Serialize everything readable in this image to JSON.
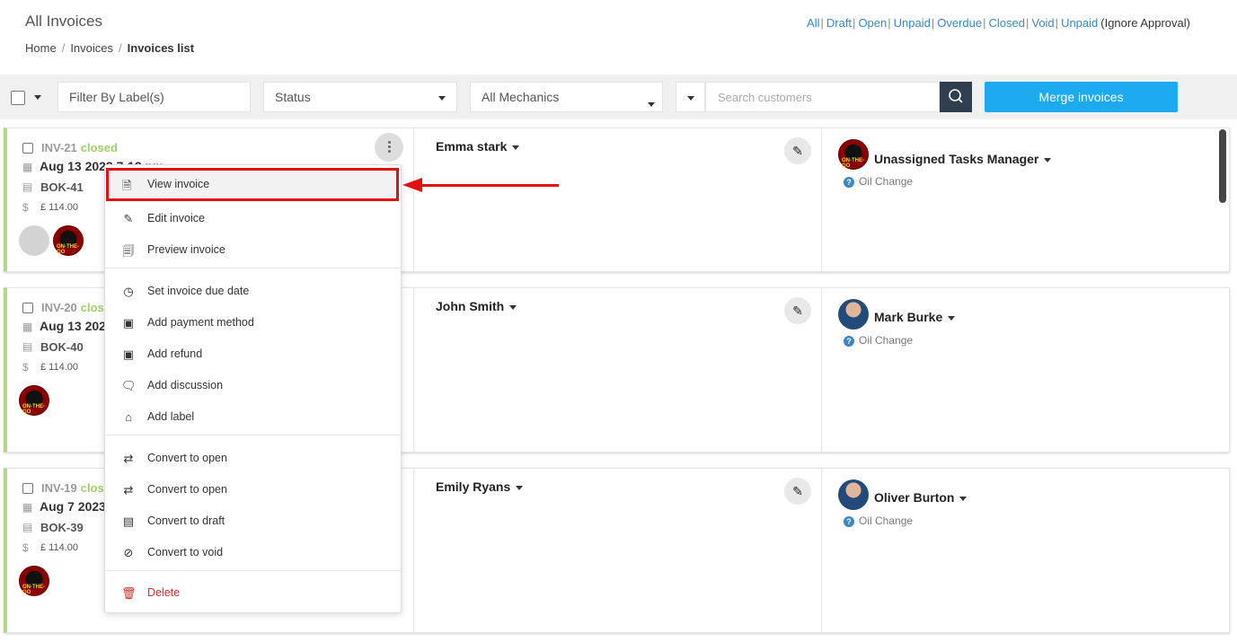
{
  "header": {
    "title": "All Invoices",
    "breadcrumb": [
      "Home",
      "Invoices",
      "Invoices list"
    ],
    "filters": [
      "All",
      "Draft",
      "Open",
      "Unpaid",
      "Overdue",
      "Closed",
      "Void",
      "Unpaid"
    ],
    "filter_note": "(Ignore Approval)"
  },
  "toolbar": {
    "label_filter_placeholder": "Filter By Label(s)",
    "status_value": "Status",
    "mechanics_value": "All Mechanics",
    "search_placeholder": "Search customers",
    "merge_label": "Merge invoices"
  },
  "invoices": [
    {
      "id": "INV-21",
      "status": "closed",
      "date": "Aug 13 2023 7:12 pm",
      "booking": "BOK-41",
      "amount": "£ 114.00",
      "customer": "Emma stark",
      "mechanic": "Unassigned Tasks Manager",
      "task": "Oil Change"
    },
    {
      "id": "INV-20",
      "status": "closed",
      "date": "Aug 13 2023",
      "booking": "BOK-40",
      "amount": "£ 114.00",
      "customer": "John Smith",
      "mechanic": "Mark Burke",
      "task": "Oil Change"
    },
    {
      "id": "INV-19",
      "status": "closed",
      "date": "Aug 7 2023",
      "booking": "BOK-39",
      "amount": "£ 114.00",
      "customer": "Emily Ryans",
      "mechanic": "Oliver Burton",
      "task": "Oil Change"
    }
  ],
  "avatar_text": "ON-THE-GO",
  "menu": {
    "view": "View invoice",
    "edit": "Edit invoice",
    "preview": "Preview invoice",
    "due_date": "Set invoice due date",
    "payment": "Add payment method",
    "refund": "Add refund",
    "discussion": "Add discussion",
    "label": "Add label",
    "convert_open_1": "Convert to open",
    "convert_open_2": "Convert to open",
    "convert_draft": "Convert to draft",
    "convert_void": "Convert to void",
    "delete": "Delete"
  },
  "colors": {
    "accent": "#1eaaf1",
    "closed": "#9fcf6a",
    "highlight": "#e31010",
    "delete": "#d92b2b"
  }
}
